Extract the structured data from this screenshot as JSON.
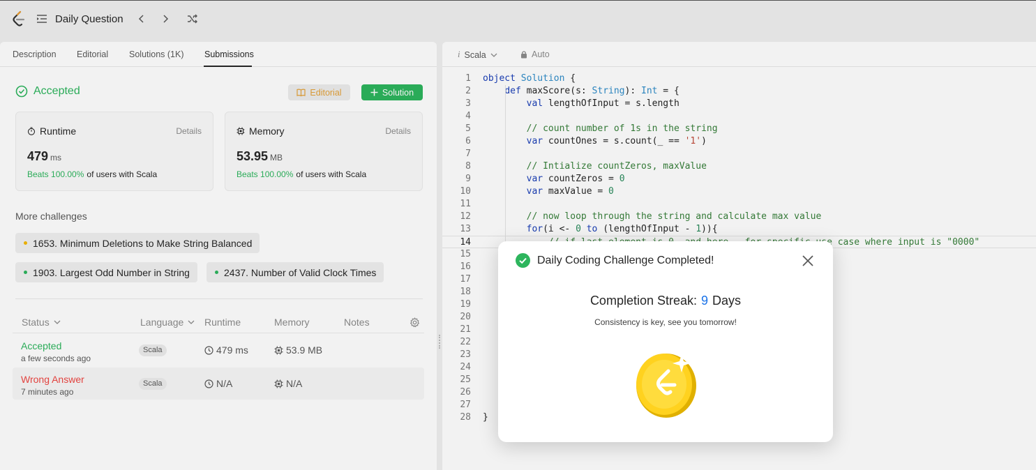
{
  "topbar": {
    "title": "Daily Question"
  },
  "left": {
    "tabs": [
      "Description",
      "Editorial",
      "Solutions (1K)",
      "Submissions"
    ],
    "active_tab": "Submissions",
    "result_status": "Accepted",
    "editorial_btn": "Editorial",
    "solution_btn": "Solution",
    "runtime": {
      "title": "Runtime",
      "details": "Details",
      "value": "479",
      "unit": "ms",
      "beats": "Beats 100.00%",
      "beats_rest": "of users with Scala"
    },
    "memory": {
      "title": "Memory",
      "details": "Details",
      "value": "53.95",
      "unit": "MB",
      "beats": "Beats 100.00%",
      "beats_rest": "of users with Scala"
    },
    "more_challenges_title": "More challenges",
    "challenges": [
      {
        "label": "1653. Minimum Deletions to Make String Balanced",
        "color": "#f5b800"
      },
      {
        "label": "1903. Largest Odd Number in String",
        "color": "#2db55d"
      },
      {
        "label": "2437. Number of Valid Clock Times",
        "color": "#2db55d"
      }
    ],
    "table": {
      "headers": [
        "Status",
        "Language",
        "Runtime",
        "Memory",
        "Notes"
      ],
      "rows": [
        {
          "status": "Accepted",
          "time": "a few seconds ago",
          "language": "Scala",
          "runtime": "479 ms",
          "memory": "53.9 MB",
          "status_color": "#2db55d"
        },
        {
          "status": "Wrong Answer",
          "time": "7 minutes ago",
          "language": "Scala",
          "runtime": "N/A",
          "memory": "N/A",
          "status_color": "#ef4743"
        }
      ]
    }
  },
  "editor": {
    "language": "Scala",
    "mode": "Auto",
    "current_line": 14,
    "lines": [
      "object Solution {",
      "    def maxScore(s: String): Int = {",
      "        val lengthOfInput = s.length",
      "",
      "        // count number of 1s in the string",
      "        var countOnes = s.count(_ == '1')",
      "",
      "        // Intialize countZeros, maxValue",
      "        var countZeros = 0",
      "        var maxValue = 0",
      "",
      "        // now loop through the string and calculate max value",
      "        for(i <- 0 to (lengthOfInput - 1)){",
      "            // if last element is 0, and here - for specific use case where input is \"0000\"",
      "",
      "",
      "",
      "",
      "",
      "",
      "",
      "",
      "",
      "                                                          )",
      "",
      "",
      "",
      "}"
    ]
  },
  "modal": {
    "title": "Daily Coding Challenge Completed!",
    "streak_label": "Completion Streak:",
    "streak_value": "9",
    "streak_unit": "Days",
    "message": "Consistency is key, see you tomorrow!"
  }
}
